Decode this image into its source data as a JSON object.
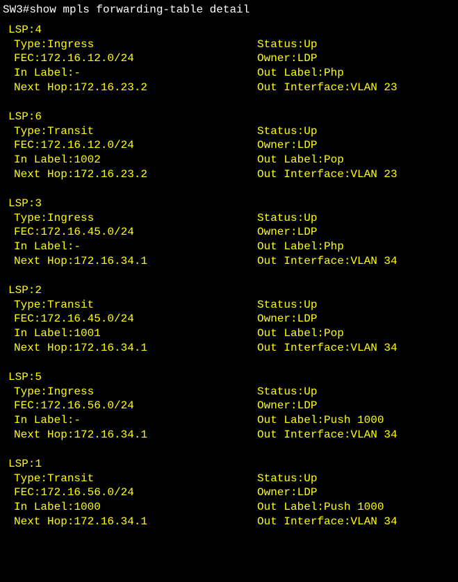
{
  "prompt": {
    "host": "SW3#",
    "command": "show mpls forwarding-table detail"
  },
  "lsps": [
    {
      "id": "LSP:4",
      "left": [
        "Type:Ingress",
        "FEC:172.16.12.0/24",
        "In Label:-",
        "Next Hop:172.16.23.2"
      ],
      "right": [
        "Status:Up",
        "Owner:LDP",
        "Out Label:Php",
        "Out Interface:VLAN 23"
      ]
    },
    {
      "id": "LSP:6",
      "left": [
        "Type:Transit",
        "FEC:172.16.12.0/24",
        "In Label:1002",
        "Next Hop:172.16.23.2"
      ],
      "right": [
        "Status:Up",
        "Owner:LDP",
        "Out Label:Pop",
        "Out Interface:VLAN 23"
      ]
    },
    {
      "id": "LSP:3",
      "left": [
        "Type:Ingress",
        "FEC:172.16.45.0/24",
        "In Label:-",
        "Next Hop:172.16.34.1"
      ],
      "right": [
        "Status:Up",
        "Owner:LDP",
        "Out Label:Php",
        "Out Interface:VLAN 34"
      ]
    },
    {
      "id": "LSP:2",
      "left": [
        "Type:Transit",
        "FEC:172.16.45.0/24",
        "In Label:1001",
        "Next Hop:172.16.34.1"
      ],
      "right": [
        "Status:Up",
        "Owner:LDP",
        "Out Label:Pop",
        "Out Interface:VLAN 34"
      ]
    },
    {
      "id": "LSP:5",
      "left": [
        "Type:Ingress",
        "FEC:172.16.56.0/24",
        "In Label:-",
        "Next Hop:172.16.34.1"
      ],
      "right": [
        "Status:Up",
        "Owner:LDP",
        "Out Label:Push 1000",
        "Out Interface:VLAN 34"
      ]
    },
    {
      "id": "LSP:1",
      "left": [
        "Type:Transit",
        "FEC:172.16.56.0/24",
        "In Label:1000",
        "Next Hop:172.16.34.1"
      ],
      "right": [
        "Status:Up",
        "Owner:LDP",
        "Out Label:Push 1000",
        "Out Interface:VLAN 34"
      ]
    }
  ]
}
